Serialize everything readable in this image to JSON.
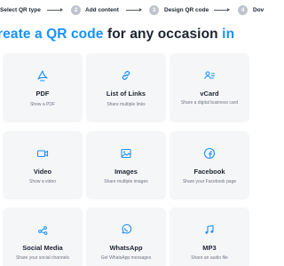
{
  "stepper": {
    "step1_label": "Select QR type",
    "step2_number": "2",
    "step2_label": "Add content",
    "step3_number": "3",
    "step3_label": "Design QR code",
    "step4_number": "4",
    "step4_label": "Dov"
  },
  "heading": {
    "part1": "reate a QR code",
    "part2": "for any occasion",
    "part3": "in"
  },
  "accent_color": "#1a91ff",
  "cards": [
    {
      "icon": "pdf-icon",
      "title": "PDF",
      "desc": "Show a PDF"
    },
    {
      "icon": "link-icon",
      "title": "List of Links",
      "desc": "Share multiple links"
    },
    {
      "icon": "vcard-icon",
      "title": "vCard",
      "desc": "Share a digital business card"
    },
    {
      "icon": "video-icon",
      "title": "Video",
      "desc": "Show a video"
    },
    {
      "icon": "images-icon",
      "title": "Images",
      "desc": "Share multiple images"
    },
    {
      "icon": "facebook-icon",
      "title": "Facebook",
      "desc": "Share your Facebook page"
    },
    {
      "icon": "social-media-icon",
      "title": "Social Media",
      "desc": "Share your social channels"
    },
    {
      "icon": "whatsapp-icon",
      "title": "WhatsApp",
      "desc": "Get WhatsApp messages"
    },
    {
      "icon": "music-icon",
      "title": "MP3",
      "desc": "Share an audio file"
    }
  ]
}
